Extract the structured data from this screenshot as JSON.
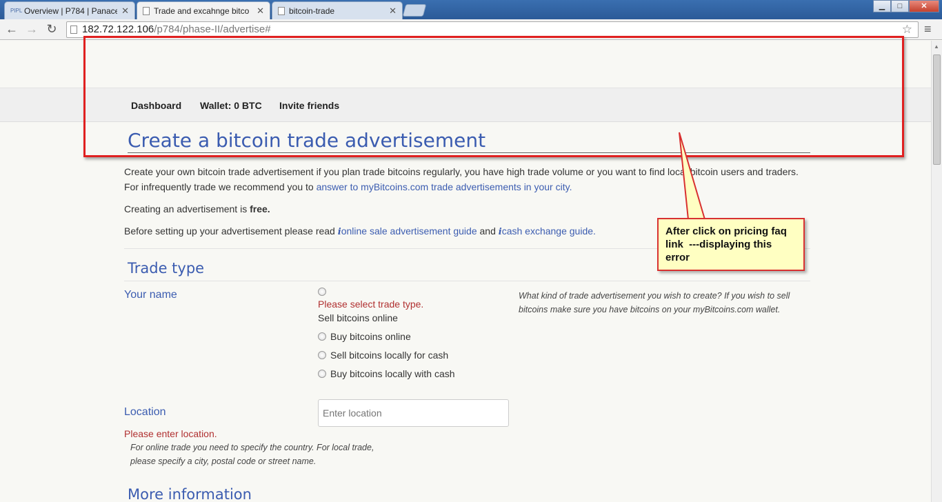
{
  "browser": {
    "tabs": [
      {
        "icon": "PIPL",
        "title": "Overview | P784 | Panacea",
        "active": false
      },
      {
        "icon": "",
        "title": "Trade and excahnge bitco",
        "active": true
      },
      {
        "icon": "",
        "title": "bitcoin-trade",
        "active": false
      }
    ],
    "url_host": "182.72.122.106",
    "url_path": "/p784/phase-II/advertise#",
    "window_buttons": {
      "minimize": "▁",
      "maximize": "□",
      "close": "✕"
    },
    "nav": {
      "back": "←",
      "forward": "→",
      "reload": "↻",
      "star": "☆",
      "menu": "≡"
    }
  },
  "navbar": {
    "dashboard": "Dashboard",
    "wallet": "Wallet: 0 BTC",
    "invite": "Invite friends"
  },
  "content": {
    "heading": "Create a bitcoin trade advertisement",
    "intro_text": "Create your own bitcoin trade advertisement if you plan trade bitcoins regularly, you have high trade volume or you want to find local bitcoin users and traders. For infrequently trade we recommend you to ",
    "intro_link": "answer to myBitcoins.com trade advertisements in your city.",
    "free_prefix": "Creating an advertisement is ",
    "free_word": "free.",
    "read_prefix": "Before setting up your advertisement please read ",
    "info_glyph": "i",
    "guide1": "online sale advertisement guide",
    "and_word": " and ",
    "guide2": "cash exchange guide."
  },
  "trade_type": {
    "section_title": "Trade type",
    "field_label": "Your name",
    "error": "Please select trade type.",
    "options": [
      "Sell bitcoins online",
      "Buy bitcoins online",
      "Sell bitcoins locally for cash",
      "Buy bitcoins locally with cash"
    ],
    "help": "What kind of trade advertisement you wish to create? If you wish to sell bitcoins make sure you have bitcoins on your myBitcoins.com wallet."
  },
  "location": {
    "label": "Location",
    "placeholder": "Enter location",
    "error": "Please enter location.",
    "help": "For online trade you need to specify the country. For local trade, please specify a city, postal code or street name."
  },
  "more_info": {
    "section_title": "More information"
  },
  "annotation": {
    "callout_text": "After click on pricing faq\nlink  ---displaying this\nerror",
    "colors": {
      "box": "#e02020",
      "callout_bg": "#ffffc2"
    }
  }
}
